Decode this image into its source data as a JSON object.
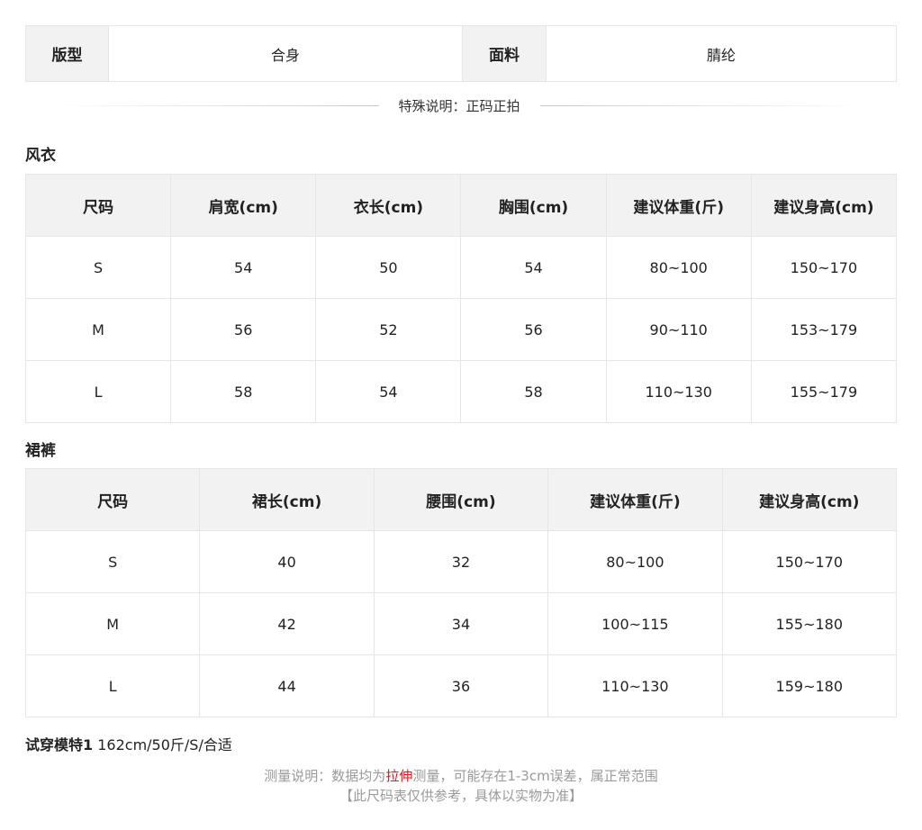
{
  "info": {
    "fit_label": "版型",
    "fit_value": "合身",
    "fabric_label": "面料",
    "fabric_value": "腈纶"
  },
  "special_note": "特殊说明：正码正拍",
  "coat": {
    "title": "风衣",
    "headers": [
      "尺码",
      "肩宽(cm)",
      "衣长(cm)",
      "胸围(cm)",
      "建议体重(斤)",
      "建议身高(cm)"
    ],
    "rows": [
      [
        "S",
        "54",
        "50",
        "54",
        "80~100",
        "150~170"
      ],
      [
        "M",
        "56",
        "52",
        "56",
        "90~110",
        "153~179"
      ],
      [
        "L",
        "58",
        "54",
        "58",
        "110~130",
        "155~179"
      ]
    ]
  },
  "skirt": {
    "title": "裙裤",
    "headers": [
      "尺码",
      "裙长(cm)",
      "腰围(cm)",
      "建议体重(斤)",
      "建议身高(cm)"
    ],
    "rows": [
      [
        "S",
        "40",
        "32",
        "80~100",
        "150~170"
      ],
      [
        "M",
        "42",
        "34",
        "100~115",
        "155~180"
      ],
      [
        "L",
        "44",
        "36",
        "110~130",
        "159~180"
      ]
    ]
  },
  "model": {
    "label": "试穿模特1",
    "value": "162cm/50斤/S/合适"
  },
  "measure_note": {
    "prefix": "测量说明：数据均为",
    "highlight": "拉伸",
    "suffix": "测量，可能存在1-3cm误差，属正常范围",
    "line2": "【此尺码表仅供参考，具体以实物为准】"
  },
  "colors": {
    "header_bg": "#f2f2f2",
    "border": "#e6e6e6",
    "highlight": "#e4161b",
    "note_gray": "#9a9a9a"
  }
}
